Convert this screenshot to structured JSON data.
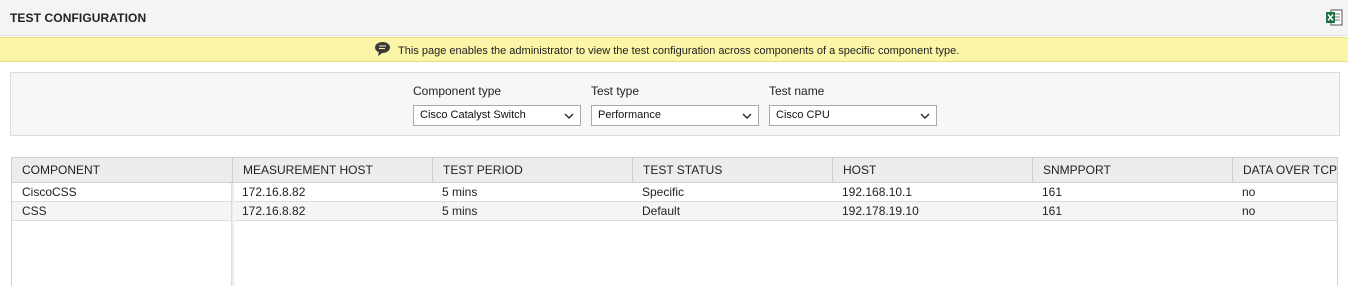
{
  "header": {
    "title": "TEST CONFIGURATION",
    "export_icon": "excel-export-icon"
  },
  "info": {
    "icon": "speech-bubble-icon",
    "message": "This page enables the administrator to view the test configuration across components of a specific component type."
  },
  "filters": {
    "component_type": {
      "label": "Component type",
      "value": "Cisco Catalyst Switch"
    },
    "test_type": {
      "label": "Test type",
      "value": "Performance"
    },
    "test_name": {
      "label": "Test name",
      "value": "Cisco CPU"
    }
  },
  "grid": {
    "columns": [
      "COMPONENT",
      "MEASUREMENT HOST",
      "TEST PERIOD",
      "TEST STATUS",
      "HOST",
      "SNMPPORT",
      "DATA OVER TCP"
    ],
    "rows": [
      [
        "CiscoCSS",
        "172.16.8.82",
        "5 mins",
        "Specific",
        "192.168.10.1",
        "161",
        "no"
      ],
      [
        "CSS",
        "172.16.8.82",
        "5 mins",
        "Default",
        "192.178.19.10",
        "161",
        "no"
      ]
    ]
  },
  "colors": {
    "info_background": "#faf5a7",
    "header_background": "#f4f4f4",
    "grid_header_background": "#ececec",
    "excel_green": "#1e7145"
  }
}
